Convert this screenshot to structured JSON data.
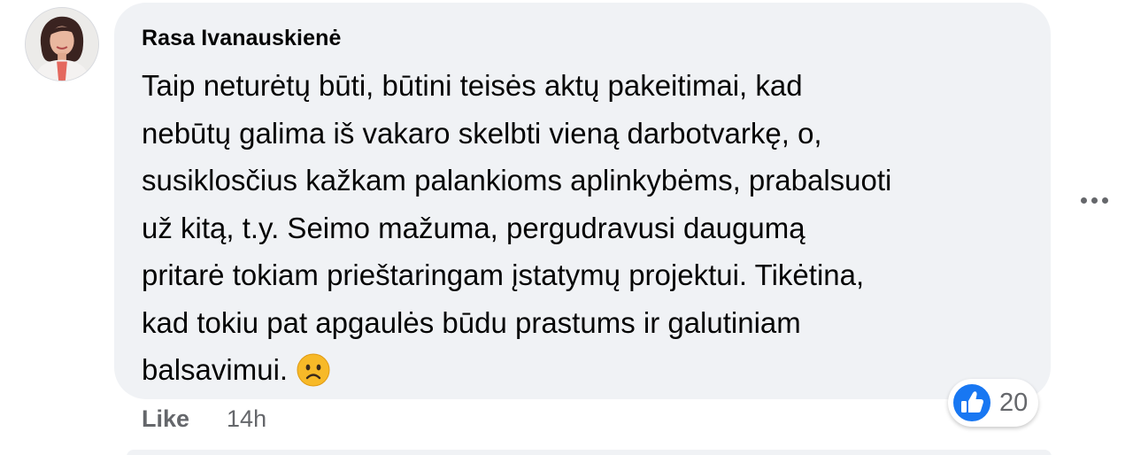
{
  "comment": {
    "author": "Rasa Ivanauskienė",
    "avatar_icon": "profile-photo",
    "text_lines": [
      "Taip neturėtų būti, būtini teisės aktų pakeitimai, kad",
      "nebūtų galima iš vakaro skelbti vieną darbotvarkę, o,",
      "susiklosčius kažkam palankioms aplinkybėms, prabalsuoti",
      "už kitą, t.y. Seimo mažuma, pergudravusi daugumą",
      "pritarė tokiam prieštaringam įstatymų projektui. Tikėtina,",
      "kad tokiu pat apgaulės būdu prastums ir galutiniam",
      "balsavimui."
    ],
    "emoji_icon": "frowning-face-emoji",
    "reaction_icon": "like-thumbs-up-icon",
    "reaction_count": "20",
    "more_icon": "more-options-icon"
  },
  "actions": {
    "like_label": "Like",
    "timestamp": "14h"
  },
  "colors": {
    "bubble": "#f0f2f5",
    "text": "#050505",
    "secondary": "#65676b",
    "like_blue": "#1877f2"
  }
}
